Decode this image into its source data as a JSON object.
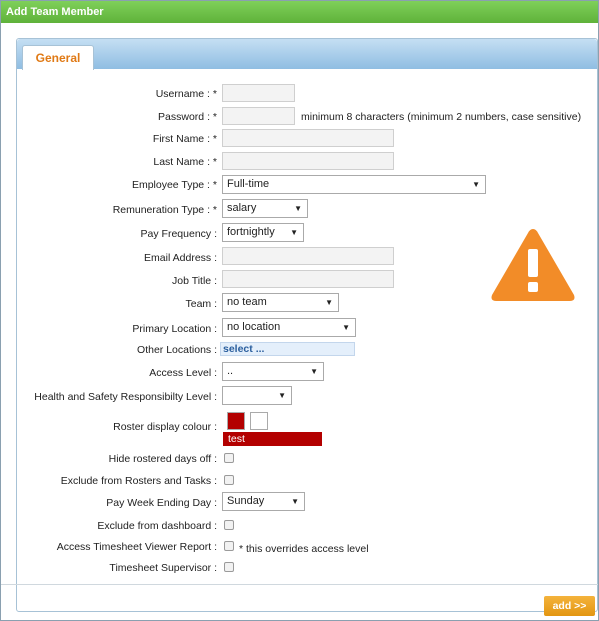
{
  "window": {
    "title": "Add Team Member"
  },
  "tabs": [
    {
      "label": "General"
    }
  ],
  "form": {
    "username_label": "Username :",
    "password_label": "Password :",
    "password_hint": "minimum 8 characters (minimum 2 numbers, case sensitive)",
    "first_name_label": "First Name :",
    "last_name_label": "Last Name :",
    "employee_type_label": "Employee Type :",
    "employee_type_value": "Full-time",
    "remuneration_type_label": "Remuneration Type :",
    "remuneration_type_value": "salary",
    "pay_frequency_label": "Pay Frequency :",
    "pay_frequency_value": "fortnightly",
    "email_label": "Email Address :",
    "job_title_label": "Job Title :",
    "team_label": "Team :",
    "team_value": "no team",
    "primary_location_label": "Primary Location :",
    "primary_location_value": "no location",
    "other_locations_label": "Other Locations :",
    "other_locations_value": "select ...",
    "access_level_label": "Access Level :",
    "access_level_value": "..",
    "health_safety_label": "Health and Safety Responsibilty Level :",
    "health_safety_value": "",
    "roster_colour_label": "Roster display colour :",
    "roster_colour_preview_text": "test",
    "hide_rostered_label": "Hide rostered days off :",
    "exclude_rosters_label": "Exclude from Rosters and Tasks :",
    "pay_week_label": "Pay Week Ending Day :",
    "pay_week_value": "Sunday",
    "exclude_dashboard_label": "Exclude from dashboard :",
    "timesheet_viewer_label": "Access Timesheet Viewer Report :",
    "timesheet_viewer_note": "* this overrides access level",
    "timesheet_supervisor_label": "Timesheet Supervisor :",
    "required_mark": "*"
  },
  "colors": {
    "title_green": "#5fb23a",
    "roster_red": "#b30000",
    "warning_orange": "#f28c28",
    "button_orange": "#e8a020",
    "tab_orange": "#e07a16"
  },
  "icons": {
    "warning": "warning-icon",
    "dropdown": "chevron-down-icon"
  },
  "footer": {
    "add_button_label": "add >>"
  }
}
